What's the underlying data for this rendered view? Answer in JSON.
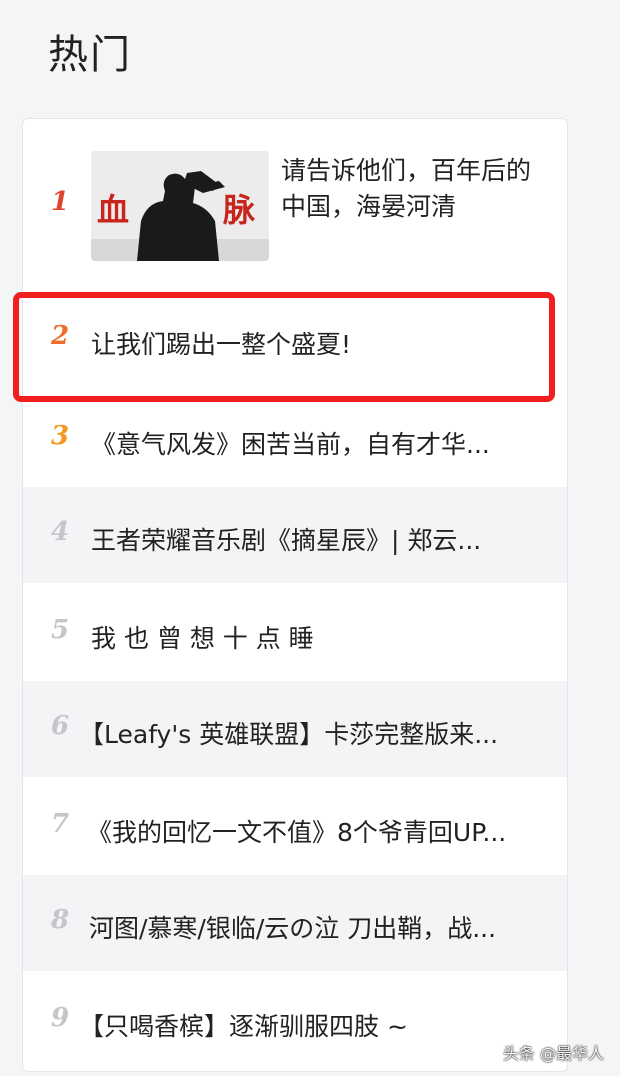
{
  "section_title": "热门",
  "items": [
    {
      "rank": "1",
      "title": "请告诉他们，百年后的中国，海晏河清",
      "thumbnail_text": "血 脉"
    },
    {
      "rank": "2",
      "title": "让我们踢出一整个盛夏!"
    },
    {
      "rank": "3",
      "title": "《意气风发》困苦当前，自有才华..."
    },
    {
      "rank": "4",
      "title": "王者荣耀音乐剧《摘星辰》| 郑云..."
    },
    {
      "rank": "5",
      "title": "我 也 曾 想 十 点 睡"
    },
    {
      "rank": "6",
      "title": "【Leafy's 英雄联盟】卡莎完整版来..."
    },
    {
      "rank": "7",
      "title": "《我的回忆一文不值》8个爷青回UP..."
    },
    {
      "rank": "8",
      "title": "河图/慕寒/银临/云の泣 刀出鞘，战..."
    },
    {
      "rank": "9",
      "title": "【只喝香槟】逐渐驯服四肢 ~"
    }
  ],
  "watermark": "头条 @最华人",
  "colors": {
    "highlight_border": "#f01e1e",
    "rank1": "#e0432e",
    "rank2": "#ef6c2d",
    "rank3": "#f2991e",
    "rank_default": "#c4c6ca"
  }
}
